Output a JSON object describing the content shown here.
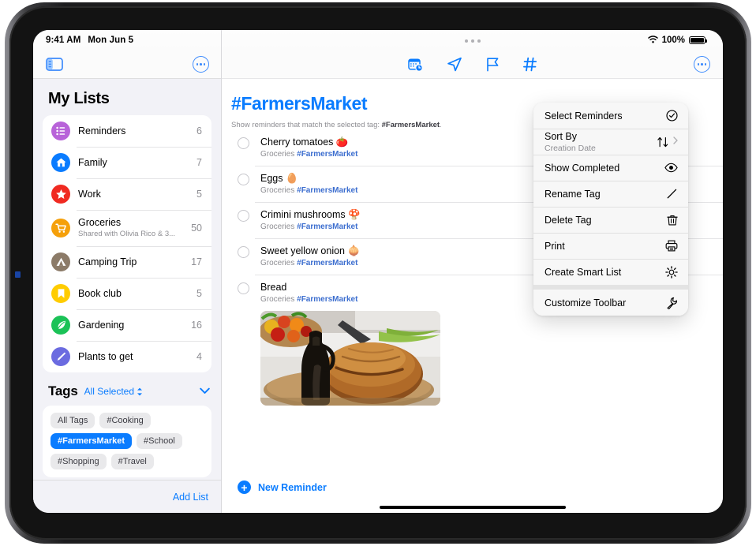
{
  "status_bar": {
    "time": "9:41 AM",
    "date": "Mon Jun 5",
    "battery_percent": "100%",
    "wifi_icon": "wifi-icon",
    "battery_icon": "battery-icon"
  },
  "sidebar": {
    "toggle_icon": "sidebar-toggle-icon",
    "more_icon": "more-ellipsis-icon",
    "title": "My Lists",
    "lists": [
      {
        "name": "Reminders",
        "count": "6",
        "icon": "list-bullet-icon",
        "color": "#b863d9",
        "subtitle": ""
      },
      {
        "name": "Family",
        "count": "7",
        "icon": "house-icon",
        "color": "#0a7cff",
        "subtitle": ""
      },
      {
        "name": "Work",
        "count": "5",
        "icon": "star-icon",
        "color": "#f02a21",
        "subtitle": ""
      },
      {
        "name": "Groceries",
        "count": "50",
        "icon": "cart-icon",
        "color": "#f5a00b",
        "subtitle": "Shared with Olivia Rico & 3..."
      },
      {
        "name": "Camping Trip",
        "count": "17",
        "icon": "tent-icon",
        "color": "#8c7b68",
        "subtitle": ""
      },
      {
        "name": "Book club",
        "count": "5",
        "icon": "bookmark-icon",
        "color": "#ffcc00",
        "subtitle": ""
      },
      {
        "name": "Gardening",
        "count": "16",
        "icon": "leaf-icon",
        "color": "#1bc257",
        "subtitle": ""
      },
      {
        "name": "Plants to get",
        "count": "4",
        "icon": "pen-icon",
        "color": "#6b6be0",
        "subtitle": ""
      }
    ],
    "tags_section": {
      "title": "Tags",
      "selector_label": "All Selected",
      "selector_icon": "updown-chevron-icon",
      "collapse_icon": "chevron-down-icon",
      "tags": [
        {
          "label": "All Tags",
          "selected": false
        },
        {
          "label": "#Cooking",
          "selected": false
        },
        {
          "label": "#FarmersMarket",
          "selected": true
        },
        {
          "label": "#School",
          "selected": false
        },
        {
          "label": "#Shopping",
          "selected": false
        },
        {
          "label": "#Travel",
          "selected": false
        }
      ]
    },
    "add_list_label": "Add List"
  },
  "main": {
    "toolbar_icons": [
      "calendar-clock-icon",
      "location-arrow-icon",
      "flag-icon",
      "hashtag-icon"
    ],
    "more_icon": "more-ellipsis-icon",
    "title": "#FarmersMarket",
    "subtitle_prefix": "Show reminders that match the selected tag: ",
    "subtitle_tag": "#FarmersMarket",
    "subtitle_suffix": ".",
    "reminders": [
      {
        "title": "Cherry tomatoes 🍅",
        "list": "Groceries",
        "tag": "#FarmersMarket",
        "has_image": false
      },
      {
        "title": "Eggs 🥚",
        "list": "Groceries",
        "tag": "#FarmersMarket",
        "has_image": false
      },
      {
        "title": "Crimini mushrooms 🍄",
        "list": "Groceries",
        "tag": "#FarmersMarket",
        "has_image": false
      },
      {
        "title": "Sweet yellow onion 🧅",
        "list": "Groceries",
        "tag": "#FarmersMarket",
        "has_image": false
      },
      {
        "title": "Bread",
        "list": "Groceries",
        "tag": "#FarmersMarket",
        "has_image": true
      }
    ],
    "new_reminder_label": "New Reminder",
    "new_reminder_icon": "plus-circle-icon"
  },
  "context_menu": {
    "items": [
      {
        "label": "Select Reminders",
        "sub": "",
        "icon": "check-circle-icon",
        "chevron": false,
        "group_gap": false
      },
      {
        "label": "Sort By",
        "sub": "Creation Date",
        "icon": "sort-arrows-icon",
        "chevron": true,
        "group_gap": false
      },
      {
        "label": "Show Completed",
        "sub": "",
        "icon": "eye-icon",
        "chevron": false,
        "group_gap": false
      },
      {
        "label": "Rename Tag",
        "sub": "",
        "icon": "pencil-icon",
        "chevron": false,
        "group_gap": false
      },
      {
        "label": "Delete Tag",
        "sub": "",
        "icon": "trash-icon",
        "chevron": false,
        "group_gap": false
      },
      {
        "label": "Print",
        "sub": "",
        "icon": "printer-icon",
        "chevron": false,
        "group_gap": false
      },
      {
        "label": "Create Smart List",
        "sub": "",
        "icon": "gear-icon",
        "chevron": false,
        "group_gap": false
      },
      {
        "label": "Customize Toolbar",
        "sub": "",
        "icon": "wrench-icon",
        "chevron": false,
        "group_gap": true
      }
    ]
  },
  "colors": {
    "accent": "#0a7cff",
    "tag_blue": "#3c6ecf",
    "sidebar_bg": "#f2f2f7",
    "menu_bg": "#f7f7f7"
  }
}
